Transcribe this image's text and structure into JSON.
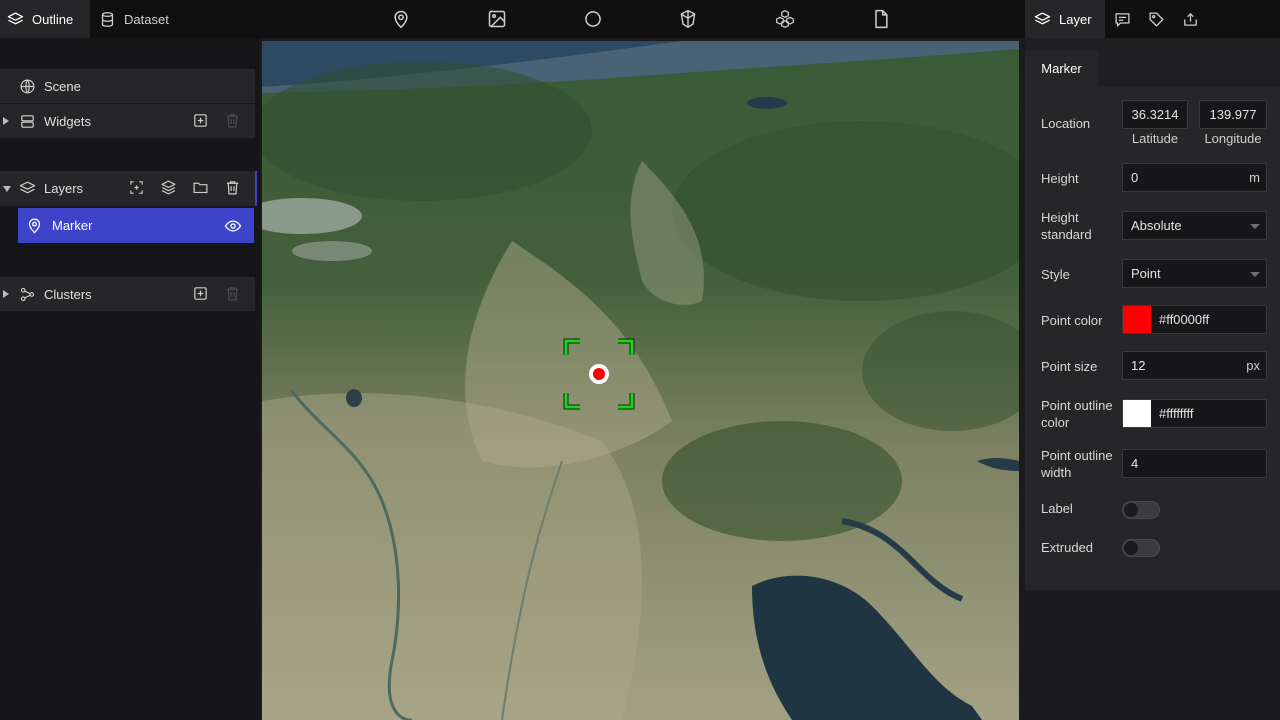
{
  "left_tabs": [
    {
      "label": "Outline",
      "icon": "layers-icon",
      "active": true
    },
    {
      "label": "Dataset",
      "icon": "database-icon",
      "active": false
    }
  ],
  "toolbar": [
    {
      "icon": "map-pin-icon"
    },
    {
      "icon": "image-icon"
    },
    {
      "icon": "circle-icon"
    },
    {
      "icon": "box-icon"
    },
    {
      "icon": "cubes-icon"
    },
    {
      "icon": "file-icon"
    }
  ],
  "right_tabs": [
    {
      "label": "Layer",
      "icon": "layers-icon",
      "active": true
    },
    {
      "icon": "message-icon"
    },
    {
      "icon": "tag-icon"
    },
    {
      "icon": "export-icon"
    }
  ],
  "outline": {
    "scene": {
      "label": "Scene",
      "icon": "globe-icon"
    },
    "widgets": {
      "label": "Widgets",
      "icon": "server-icon"
    },
    "layers": {
      "label": "Layers",
      "icon": "layers-icon"
    },
    "marker": {
      "label": "Marker",
      "icon": "map-pin-icon",
      "visible": true
    },
    "clusters": {
      "label": "Clusters",
      "icon": "cluster-icon"
    }
  },
  "map": {
    "marker_color": "#ff0000",
    "selection_color": "#1ed11e"
  },
  "properties": {
    "tab": "Marker",
    "location": {
      "label": "Location",
      "latitude": "36.3214",
      "latitude_label": "Latitude",
      "longitude": "139.977",
      "longitude_label": "Longitude"
    },
    "height": {
      "label": "Height",
      "value": "0",
      "unit": "m"
    },
    "height_standard": {
      "label": "Height standard",
      "value": "Absolute"
    },
    "style": {
      "label": "Style",
      "value": "Point"
    },
    "point_color": {
      "label": "Point color",
      "value": "#ff0000ff",
      "swatch": "#ff0000"
    },
    "point_size": {
      "label": "Point size",
      "value": "12",
      "unit": "px"
    },
    "point_outline_color": {
      "label": "Point outline color",
      "value": "#ffffffff",
      "swatch": "#ffffff"
    },
    "point_outline_width": {
      "label": "Point outline width",
      "value": "4"
    },
    "label_toggle": {
      "label": "Label",
      "on": false
    },
    "extruded_toggle": {
      "label": "Extruded",
      "on": false
    }
  },
  "colors": {
    "accent": "#3d44c9",
    "panel": "#262628",
    "background": "#161618"
  }
}
